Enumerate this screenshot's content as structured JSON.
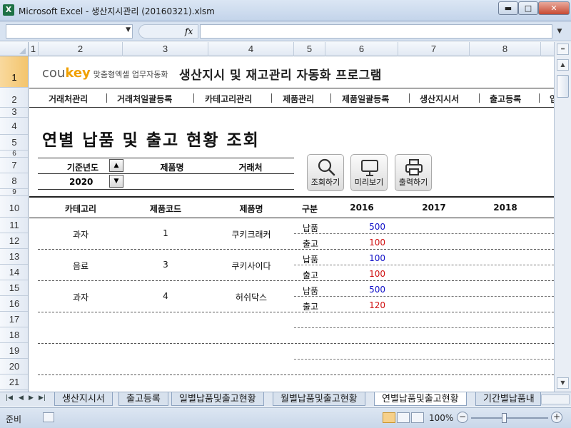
{
  "window": {
    "title": "Microsoft Excel - 생산지시관리 (20160321).xlsm",
    "app_icon": "X",
    "minimize": "▬",
    "maximize": "□",
    "close": "✕"
  },
  "formula_bar": {
    "name_box": "",
    "fx": "fx",
    "formula": ""
  },
  "columns": [
    "1",
    "2",
    "3",
    "4",
    "5",
    "6",
    "7",
    "8"
  ],
  "rows": [
    "1",
    "2",
    "3",
    "4",
    "5",
    "6",
    "7",
    "8",
    "9",
    "10",
    "11",
    "12",
    "13",
    "14",
    "15",
    "16",
    "17",
    "18",
    "19",
    "20",
    "21"
  ],
  "sheet": {
    "brand_cou": "cou",
    "brand_key": "key",
    "brand_tagline": "맞춤형엑셀 업무자동화",
    "app_title": "생산지시 및 재고관리 자동화 프로그램",
    "menu": [
      "거래처관리",
      "거래처일괄등록",
      "카테고리관리",
      "제품관리",
      "제품일괄등록",
      "생산지시서",
      "출고등록",
      "입"
    ],
    "page_title": "연별 납품 및 출고 현황 조회",
    "filter": {
      "year_label": "기준년도",
      "product_label": "제품명",
      "client_label": "거래처",
      "year_value": "2020",
      "product_value": "",
      "client_value": ""
    },
    "buttons": {
      "search": "조회하기",
      "preview": "미리보기",
      "print": "출력하기"
    },
    "table_headers": {
      "category": "카테고리",
      "product_code": "제품코드",
      "product_name": "제품명",
      "type": "구분",
      "y2016": "2016",
      "y2017": "2017",
      "y2018": "2018"
    },
    "table_rows": [
      {
        "category": "과자",
        "code": "1",
        "name": "쿠키크래커",
        "deliv_label": "납품",
        "deliv_2016": "500",
        "ship_label": "출고",
        "ship_2016": "100"
      },
      {
        "category": "음료",
        "code": "3",
        "name": "쿠키사이다",
        "deliv_label": "납품",
        "deliv_2016": "100",
        "ship_label": "출고",
        "ship_2016": "100"
      },
      {
        "category": "과자",
        "code": "4",
        "name": "허쉬닥스",
        "deliv_label": "납품",
        "deliv_2016": "500",
        "ship_label": "출고",
        "ship_2016": "120"
      }
    ]
  },
  "tabs": [
    "생산지시서",
    "출고등록",
    "일별납품및출고현황",
    "월별납품및출고현황",
    "연별납품및출고현황",
    "기간별납품내"
  ],
  "active_tab": "연별납품및출고현황",
  "status": {
    "ready": "준비",
    "zoom": "100%",
    "zoom_minus": "−",
    "zoom_plus": "+"
  },
  "colors": {
    "delivery": "#1010c8",
    "shipment": "#d01010",
    "active_row_header": "#f3c46b"
  }
}
